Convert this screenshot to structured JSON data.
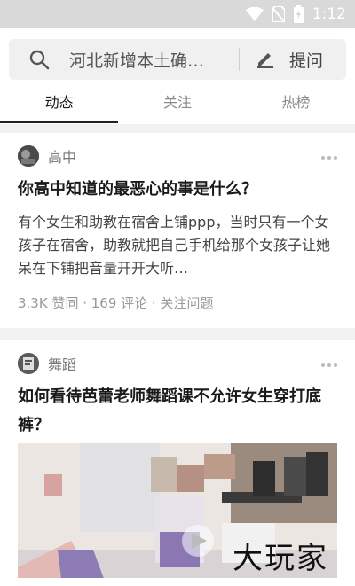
{
  "status_bar": {
    "time": "1:12"
  },
  "search": {
    "text": "河北新增本土确…",
    "ask_label": "提问"
  },
  "tabs": [
    {
      "label": "动态",
      "active": true
    },
    {
      "label": "关注",
      "active": false
    },
    {
      "label": "热榜",
      "active": false
    }
  ],
  "feed": [
    {
      "topic": "高中",
      "title": "你高中知道的最恶心的事是什么？",
      "excerpt": "有个女生和助教在宿舍上铺ppp，当时只有一个女孩子在宿舍，助教就把自己手机给那个女孩子让她呆在下铺把音量开开大听…",
      "meta": "3.3K 赞同 · 169 评论 · 关注问题"
    },
    {
      "topic": "舞蹈",
      "title": "如何看待芭蕾老师舞蹈课不允许女生穿打底裤？"
    }
  ],
  "watermark": "大玩家",
  "colors": {
    "accent": "#1a1a1a",
    "muted": "#999999",
    "status_bar": "#d9d9d9"
  }
}
